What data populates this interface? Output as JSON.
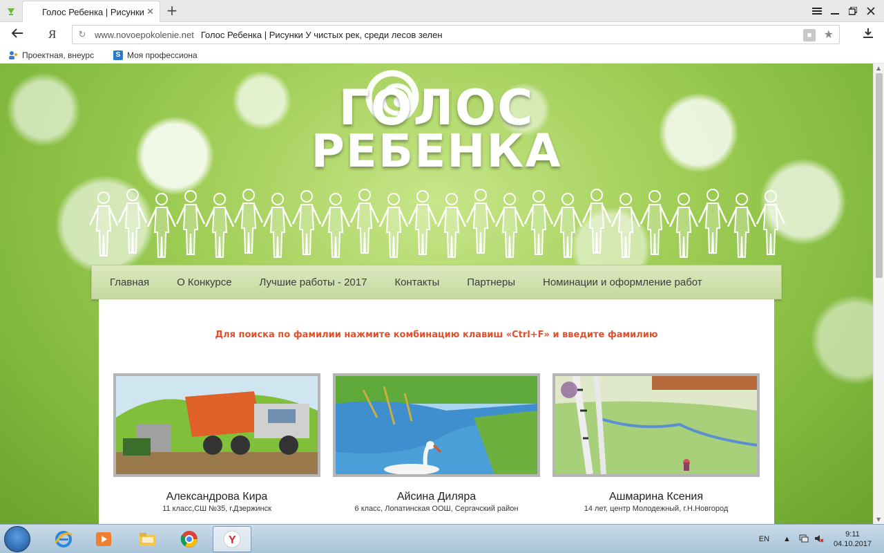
{
  "browser": {
    "tab_title": "Голос Ребенка | Рисунки",
    "tab_close": "✕",
    "new_tab": "+",
    "ya_logo": "Я",
    "url_domain": "www.novoepokolenie.net",
    "url_title": "Голос Ребенка | Рисунки У чистых рек, среди лесов зелен",
    "bookmarks": [
      {
        "label": "Проектная, внеурс",
        "color": "#3a7bd5"
      },
      {
        "label": "Моя профессиона",
        "color": "#2a7ad0"
      }
    ]
  },
  "site": {
    "logo_line1": "ГОЛОС",
    "logo_line2": "РЕБЕНКА",
    "nav": [
      "Главная",
      "О Конкурсе",
      "Лучшие работы - 2017",
      "Контакты",
      "Партнеры",
      "Номинации и оформление работ"
    ],
    "search_hint": "Для поиска по фамилии нажмите комбинацию клавиш «Ctrl+F» и введите фамилию",
    "hint_color": "#e0502a",
    "cards": [
      {
        "name": "Александрова Кира",
        "desc": "11 класс,СШ №35, г.Дзержинск"
      },
      {
        "name": "Айсина Диляра",
        "desc": "6 класс, Лопатинская ООШ, Сергачский район"
      },
      {
        "name": "Ашмарина Ксения",
        "desc": "14 лет, центр Молодежный, г.Н.Новгород"
      }
    ]
  },
  "taskbar": {
    "lang": "EN",
    "time": "9:11",
    "date": "04.10.2017"
  }
}
